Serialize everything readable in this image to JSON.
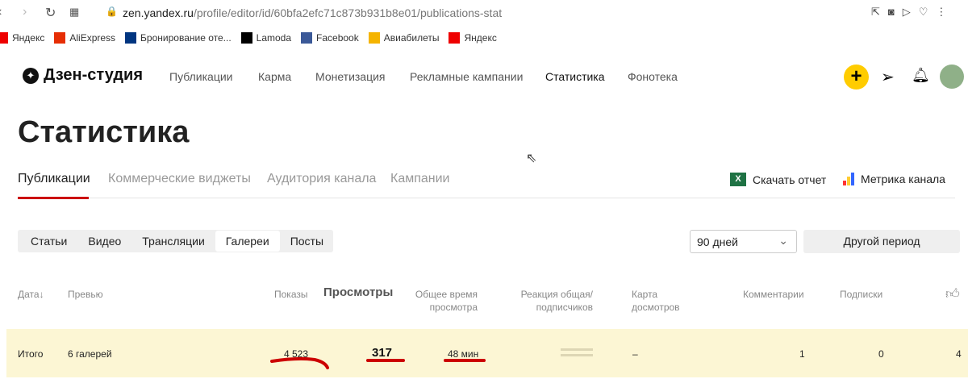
{
  "browser": {
    "url_host": "zen.yandex.ru",
    "url_path": "/profile/editor/id/60bfa2efc71c873b931b8e01/publications-stat",
    "bookmarks": [
      {
        "label": "Яндекс",
        "color": "#e00"
      },
      {
        "label": "AliExpress",
        "color": "#e62e04"
      },
      {
        "label": "Бронирование оте...",
        "color": "#003580"
      },
      {
        "label": "Lamoda",
        "color": "#000"
      },
      {
        "label": "Facebook",
        "color": "#3b5998"
      },
      {
        "label": "Авиабилеты",
        "color": "#f5b400"
      },
      {
        "label": "Яндекс",
        "color": "#e00"
      }
    ]
  },
  "header": {
    "logo": "Дзен-студия",
    "nav": [
      "Публикации",
      "Карма",
      "Монетизация",
      "Рекламные кампании",
      "Статистика",
      "Фонотека"
    ]
  },
  "page": {
    "title": "Статистика",
    "tabs": [
      "Публикации",
      "Коммерческие виджеты",
      "Аудитория канала",
      "Кампании"
    ],
    "download": "Скачать отчет",
    "metrika": "Метрика канала",
    "segments": [
      "Статьи",
      "Видео",
      "Трансляции",
      "Галереи",
      "Посты"
    ],
    "period": "90 дней",
    "other_period": "Другой период"
  },
  "table": {
    "headers": {
      "date": "Дата",
      "preview": "Превью",
      "shows": "Показы",
      "views": "Просмотры",
      "time1": "Общее время",
      "time2": "просмотра",
      "react1": "Реакция общая/",
      "react2": "подписчиков",
      "map1": "Карта",
      "map2": "досмотров",
      "comments": "Комментарии",
      "subs": "Подписки"
    },
    "total": {
      "label": "Итого",
      "preview": "6 галерей",
      "shows": "4 523",
      "views": "317",
      "time": "48 мин",
      "map": "–",
      "comments": "1",
      "subs": "0",
      "likes": "4"
    }
  },
  "colors": {
    "accent": "#ffcc00",
    "highlight": "#fcf6d4",
    "underline": "#cc0000"
  }
}
